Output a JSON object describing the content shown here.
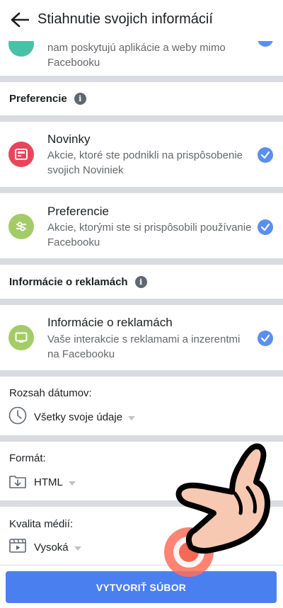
{
  "header": {
    "title": "Stiahnutie svojich informácií"
  },
  "top_partial": {
    "desc": "nam poskytujú aplikácie a weby mimo Facebooku"
  },
  "sections": {
    "preferences_head": "Preferencie",
    "ads_head": "Informácie o reklamách"
  },
  "items": [
    {
      "title": "Novinky",
      "desc": "Akcie, ktoré ste podnikli na prispôsobenie svojich Noviniek",
      "icon": "news-feed-icon",
      "color": "#e8455b",
      "checked": true
    },
    {
      "title": "Preferencie",
      "desc": "Akcie, ktorými ste si prispôsobili používanie Facebooku",
      "icon": "preferences-sliders-icon",
      "color": "#a3cc68",
      "checked": true
    },
    {
      "title": "Informácie o reklamách",
      "desc": "Vaše interakcie s reklamami a inzerentmi na Facebooku",
      "icon": "ads-screen-icon",
      "color": "#a3cc68",
      "checked": true
    }
  ],
  "options": {
    "date_range": {
      "label": "Rozsah dátumov:",
      "value": "Všetky svoje údaje",
      "icon": "clock-icon"
    },
    "format": {
      "label": "Formát:",
      "value": "HTML",
      "icon": "download-folder-icon"
    },
    "media_quality": {
      "label": "Kvalita médií:",
      "value": "Vysoká",
      "icon": "video-icon"
    }
  },
  "footer": {
    "create_label": "VYTVORIŤ SÚBOR"
  },
  "colors": {
    "accent": "#4a7ff0",
    "check": "#5a8ff0",
    "separator": "#d9dbe0",
    "secondary_text": "#65676b"
  }
}
